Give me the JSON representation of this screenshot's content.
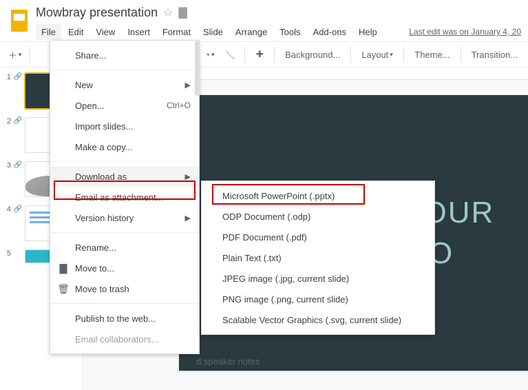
{
  "app": {
    "title": "Mowbray presentation"
  },
  "menubar": {
    "items": [
      "File",
      "Edit",
      "View",
      "Insert",
      "Format",
      "Slide",
      "Arrange",
      "Tools",
      "Add-ons",
      "Help"
    ],
    "last_edit": "Last edit was on January 4, 20"
  },
  "toolbar": {
    "background": "Background...",
    "layout": "Layout",
    "theme": "Theme...",
    "transition": "Transition..."
  },
  "thumbs": {
    "numbers": [
      "1",
      "2",
      "3",
      "4",
      "5"
    ]
  },
  "slide": {
    "line1": "THIS IS YOUR",
    "line2": "ENTATIO"
  },
  "speaker_notes_placeholder": "d speaker notes",
  "file_menu": {
    "share": "Share...",
    "new": "New",
    "open": "Open...",
    "open_shortcut": "Ctrl+O",
    "import_slides": "Import slides...",
    "make_copy": "Make a copy...",
    "download_as": "Download as",
    "email_attachment": "Email as attachment...",
    "version_history": "Version history",
    "rename": "Rename...",
    "move_to": "Move to...",
    "move_to_trash": "Move to trash",
    "publish_web": "Publish to the web...",
    "email_collab": "Email collaborators..."
  },
  "download_submenu": {
    "pptx": "Microsoft PowerPoint (.pptx)",
    "odp": "ODP Document (.odp)",
    "pdf": "PDF Document (.pdf)",
    "txt": "Plain Text (.txt)",
    "jpeg": "JPEG image (.jpg, current slide)",
    "png": "PNG image (.png, current slide)",
    "svg": "Scalable Vector Graphics (.svg, current slide)"
  }
}
